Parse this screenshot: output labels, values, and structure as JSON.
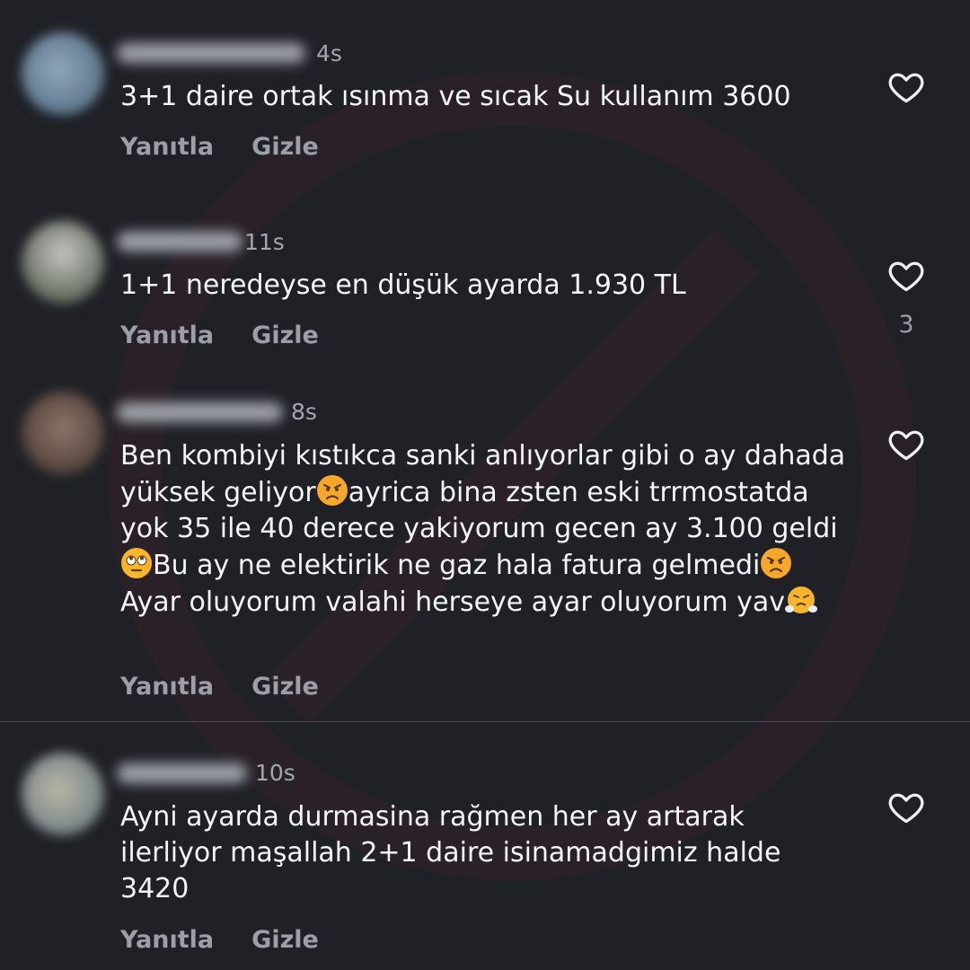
{
  "comments": [
    {
      "time": "4s",
      "text": "3+1 daire ortak ısınma ve sıcak Su kullanım 3600",
      "reply_label": "Yanıtla",
      "hide_label": "Gizle",
      "avatar_color": "#6b8aa6"
    },
    {
      "time": "11s",
      "text": "1+1 neredeyse en düşük ayarda 1.930 TL",
      "reply_label": "Yanıtla",
      "hide_label": "Gizle",
      "like_count": "3",
      "avatar_color": "#5e6b5c"
    },
    {
      "time": "8s",
      "text_parts": [
        "Ben kombiyi kıstıkca sanki anlıyorlar gibi o ay dahada yüksek geliyor",
        "ayrica bina zsten eski trrmostatda yok 35 ile 40 derece yakiyorum gecen ay 3.100 geldi",
        "Bu ay ne elektirik ne gaz hala fatura gelmedi",
        "Ayar oluyorum valahi herseye ayar oluyorum yav"
      ],
      "emojis": [
        "angry-face-emoji",
        "eye-roll-emoji",
        "angry-face-emoji",
        "steam-face-emoji"
      ],
      "reply_label": "Yanıtla",
      "hide_label": "Gizle",
      "avatar_color": "#7a6358"
    },
    {
      "time": "10s",
      "text": "Ayni ayarda durmasina rağmen her ay artarak ilerliyor maşallah 2+1 daire isinamadgimiz halde 3420",
      "reply_label": "Yanıtla",
      "hide_label": "Gizle",
      "avatar_color": "#8c8f83"
    }
  ],
  "colors": {
    "background": "#1f2127",
    "text": "#f4f5f8",
    "muted": "#9c9fa8",
    "emoji_face": "#f7b52c"
  }
}
